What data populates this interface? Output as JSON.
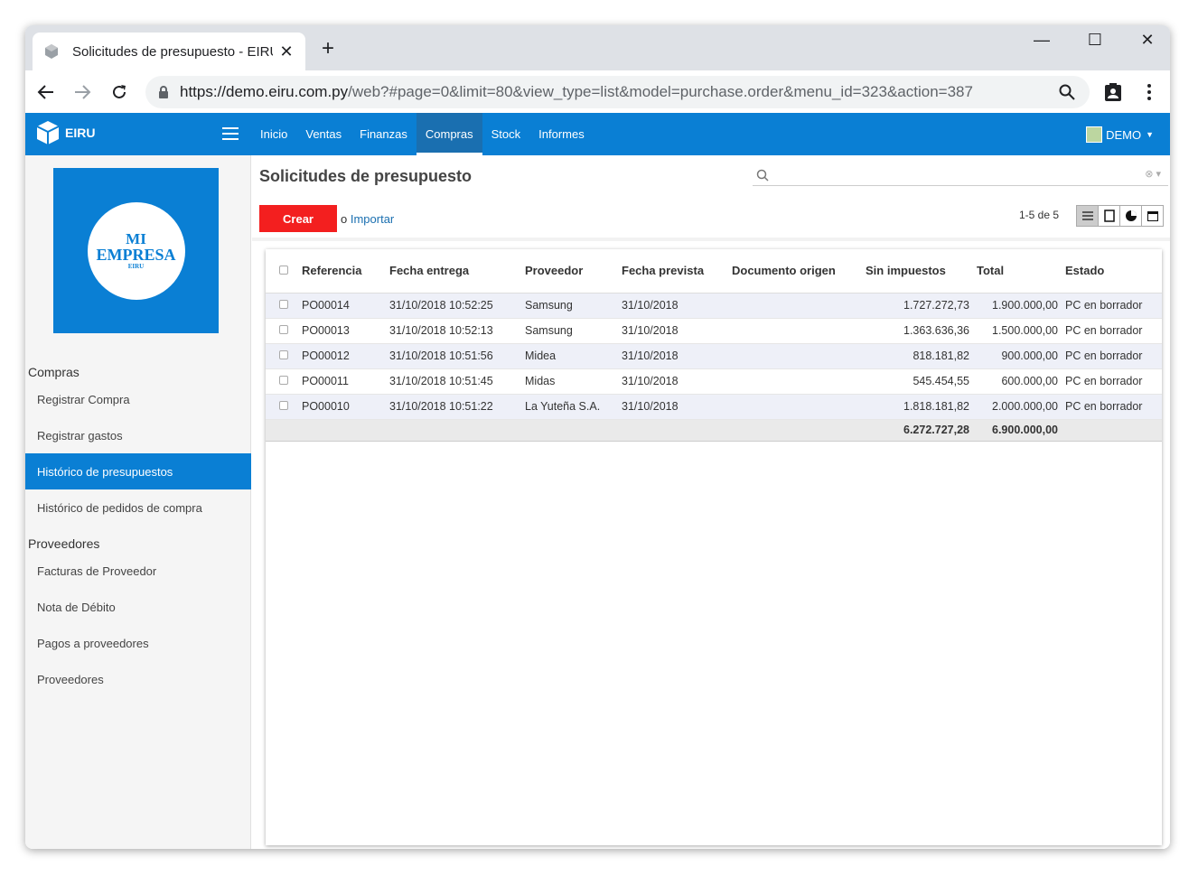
{
  "browser": {
    "tab_title": "Solicitudes de presupuesto - EIRU",
    "url_host": "https://demo.eiru.com.py",
    "url_path": "/web?#page=0&limit=80&view_type=list&model=purchase.order&menu_id=323&action=387"
  },
  "appbar": {
    "brand": "EIRU",
    "menu": [
      "Inicio",
      "Ventas",
      "Finanzas",
      "Compras",
      "Stock",
      "Informes"
    ],
    "active_menu": "Compras",
    "user": "DEMO"
  },
  "logo": {
    "line1": "MI",
    "line2": "EMPRESA",
    "line3": "EIRU"
  },
  "sidebar": {
    "section1": "Compras",
    "items1": [
      "Registrar Compra",
      "Registrar gastos",
      "Histórico de presupuestos",
      "Histórico de pedidos de compra"
    ],
    "section2": "Proveedores",
    "items2": [
      "Facturas de Proveedor",
      "Nota de Débito",
      "Pagos a proveedores",
      "Proveedores"
    ]
  },
  "main": {
    "title": "Solicitudes de presupuesto",
    "create_label": "Crear",
    "import_prefix": "o",
    "import_label": "Importar",
    "pager": "1-5 de 5"
  },
  "table": {
    "headers": [
      "Referencia",
      "Fecha entrega",
      "Proveedor",
      "Fecha prevista",
      "Documento origen",
      "Sin impuestos",
      "Total",
      "Estado"
    ],
    "rows": [
      [
        "PO00014",
        "31/10/2018 10:52:25",
        "Samsung",
        "31/10/2018",
        "",
        "1.727.272,73",
        "1.900.000,00",
        "PC en borrador"
      ],
      [
        "PO00013",
        "31/10/2018 10:52:13",
        "Samsung",
        "31/10/2018",
        "",
        "1.363.636,36",
        "1.500.000,00",
        "PC en borrador"
      ],
      [
        "PO00012",
        "31/10/2018 10:51:56",
        "Midea",
        "31/10/2018",
        "",
        "818.181,82",
        "900.000,00",
        "PC en borrador"
      ],
      [
        "PO00011",
        "31/10/2018 10:51:45",
        "Midas",
        "31/10/2018",
        "",
        "545.454,55",
        "600.000,00",
        "PC en borrador"
      ],
      [
        "PO00010",
        "31/10/2018 10:51:22",
        "La Yuteña S.A.",
        "31/10/2018",
        "",
        "1.818.181,82",
        "2.000.000,00",
        "PC en borrador"
      ]
    ],
    "totals": {
      "untaxed": "6.272.727,28",
      "total": "6.900.000,00"
    }
  },
  "colors": {
    "brand_blue": "#0a7fd4",
    "create_red": "#f31f1f"
  }
}
